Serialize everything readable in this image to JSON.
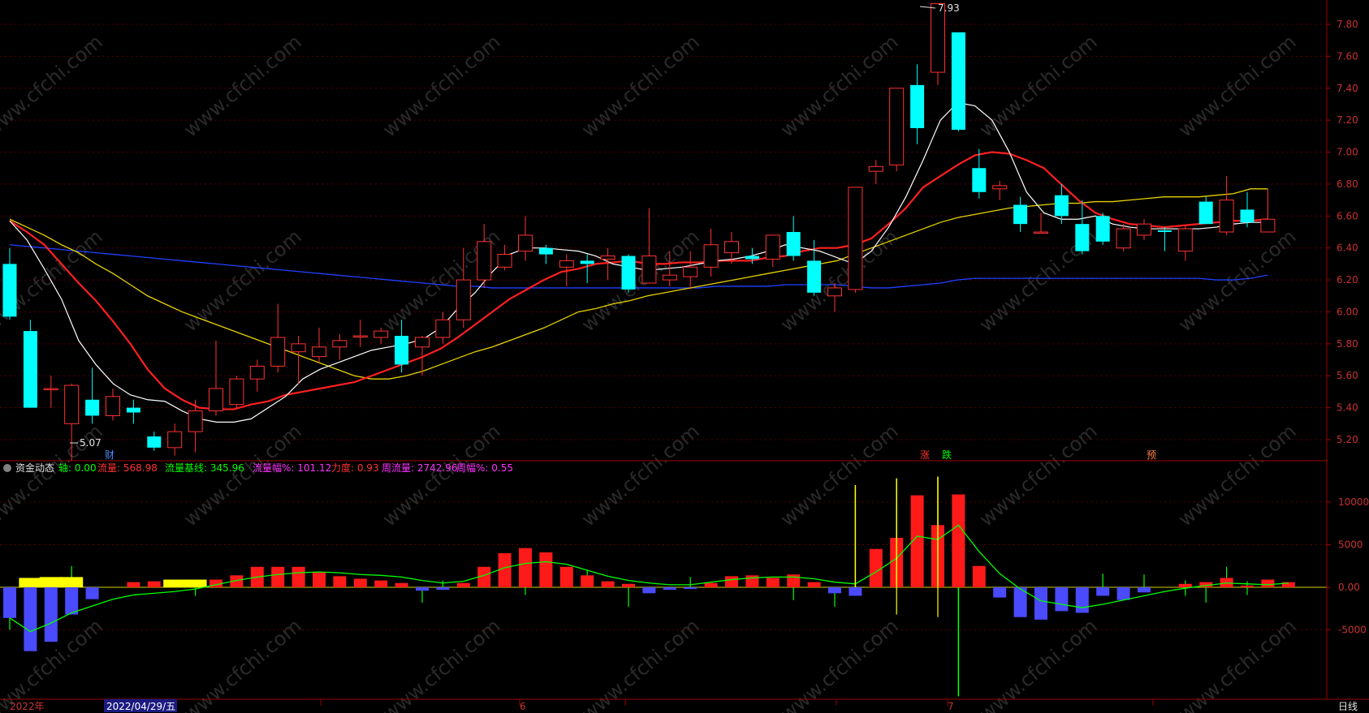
{
  "watermark": "www.cfchi.com",
  "colors": {
    "up": "#ff3232",
    "down": "#00ffff",
    "ma5": "#ffffff",
    "ma10": "#ff2020",
    "ma30": "#e6d200",
    "ma120": "#2040ff",
    "axis": "#a00000",
    "vol_pos": "#ff1a1a",
    "vol_neg": "#4a4aff",
    "vol_yellow": "#ffff00",
    "baseline": "#00ff00"
  },
  "indicator": {
    "name": "资金动态",
    "axis_label": "轴: 0.00",
    "flow_label": "流量: 568.98",
    "base_label": "流量基线: 345.96",
    "amp_label": "流量幅%: 101.12",
    "force_label": "力度: 0.93",
    "week_flow_label": "周流量: 2742.96",
    "week_amp_label": "周幅%: 0.55"
  },
  "annotations": {
    "high_label": "7.93",
    "low_label": "5.07",
    "marker_cai": "财",
    "marker_zhang": "涨",
    "marker_die": "跌",
    "marker_yu": "预"
  },
  "bottom_axis": {
    "year": "2022年",
    "cursor_date": "2022/04/29/五",
    "month6": "6",
    "month7": "7",
    "period": "日线"
  },
  "chart_data": [
    {
      "type": "candlestick",
      "ylim": [
        5.0,
        7.95
      ],
      "yticks": [
        "7.80",
        "7.60",
        "7.40",
        "7.20",
        "7.00",
        "6.80",
        "6.60",
        "6.40",
        "6.20",
        "6.00",
        "5.80",
        "5.60",
        "5.40",
        "5.20"
      ],
      "candles": [
        {
          "o": 6.3,
          "h": 6.4,
          "l": 5.95,
          "c": 5.97
        },
        {
          "o": 5.88,
          "h": 5.95,
          "l": 5.4,
          "c": 5.4
        },
        {
          "o": 5.52,
          "h": 5.6,
          "l": 5.4,
          "c": 5.52
        },
        {
          "o": 5.3,
          "h": 5.55,
          "l": 5.07,
          "c": 5.54
        },
        {
          "o": 5.45,
          "h": 5.65,
          "l": 5.3,
          "c": 5.35
        },
        {
          "o": 5.35,
          "h": 5.52,
          "l": 5.32,
          "c": 5.47
        },
        {
          "o": 5.4,
          "h": 5.45,
          "l": 5.3,
          "c": 5.37
        },
        {
          "o": 5.22,
          "h": 5.25,
          "l": 5.13,
          "c": 5.15
        },
        {
          "o": 5.15,
          "h": 5.3,
          "l": 5.1,
          "c": 5.25
        },
        {
          "o": 5.25,
          "h": 5.45,
          "l": 5.12,
          "c": 5.38
        },
        {
          "o": 5.38,
          "h": 5.82,
          "l": 5.35,
          "c": 5.52
        },
        {
          "o": 5.42,
          "h": 5.6,
          "l": 5.4,
          "c": 5.58
        },
        {
          "o": 5.58,
          "h": 5.7,
          "l": 5.5,
          "c": 5.66
        },
        {
          "o": 5.66,
          "h": 6.05,
          "l": 5.62,
          "c": 5.84
        },
        {
          "o": 5.75,
          "h": 5.85,
          "l": 5.55,
          "c": 5.8
        },
        {
          "o": 5.72,
          "h": 5.9,
          "l": 5.68,
          "c": 5.78
        },
        {
          "o": 5.78,
          "h": 5.86,
          "l": 5.7,
          "c": 5.82
        },
        {
          "o": 5.85,
          "h": 5.95,
          "l": 5.78,
          "c": 5.85
        },
        {
          "o": 5.84,
          "h": 5.9,
          "l": 5.8,
          "c": 5.88
        },
        {
          "o": 5.85,
          "h": 5.95,
          "l": 5.62,
          "c": 5.67
        },
        {
          "o": 5.78,
          "h": 5.85,
          "l": 5.6,
          "c": 5.84
        },
        {
          "o": 5.84,
          "h": 6.0,
          "l": 5.8,
          "c": 5.95
        },
        {
          "o": 5.95,
          "h": 6.4,
          "l": 5.9,
          "c": 6.2
        },
        {
          "o": 6.2,
          "h": 6.55,
          "l": 6.15,
          "c": 6.44
        },
        {
          "o": 6.28,
          "h": 6.42,
          "l": 6.26,
          "c": 6.36
        },
        {
          "o": 6.38,
          "h": 6.6,
          "l": 6.32,
          "c": 6.48
        },
        {
          "o": 6.4,
          "h": 6.42,
          "l": 6.3,
          "c": 6.36
        },
        {
          "o": 6.28,
          "h": 6.36,
          "l": 6.16,
          "c": 6.32
        },
        {
          "o": 6.32,
          "h": 6.36,
          "l": 6.18,
          "c": 6.3
        },
        {
          "o": 6.33,
          "h": 6.4,
          "l": 6.2,
          "c": 6.35
        },
        {
          "o": 6.35,
          "h": 6.36,
          "l": 6.12,
          "c": 6.14
        },
        {
          "o": 6.18,
          "h": 6.65,
          "l": 6.18,
          "c": 6.35
        },
        {
          "o": 6.2,
          "h": 6.38,
          "l": 6.16,
          "c": 6.23
        },
        {
          "o": 6.22,
          "h": 6.38,
          "l": 6.14,
          "c": 6.28
        },
        {
          "o": 6.28,
          "h": 6.52,
          "l": 6.22,
          "c": 6.42
        },
        {
          "o": 6.37,
          "h": 6.5,
          "l": 6.3,
          "c": 6.44
        },
        {
          "o": 6.35,
          "h": 6.4,
          "l": 6.3,
          "c": 6.33
        },
        {
          "o": 6.33,
          "h": 6.48,
          "l": 6.28,
          "c": 6.48
        },
        {
          "o": 6.5,
          "h": 6.6,
          "l": 6.32,
          "c": 6.35
        },
        {
          "o": 6.32,
          "h": 6.45,
          "l": 6.1,
          "c": 6.12
        },
        {
          "o": 6.1,
          "h": 6.18,
          "l": 6.0,
          "c": 6.15
        },
        {
          "o": 6.14,
          "h": 6.78,
          "l": 6.12,
          "c": 6.78
        },
        {
          "o": 6.88,
          "h": 6.95,
          "l": 6.8,
          "c": 6.91
        },
        {
          "o": 6.92,
          "h": 7.4,
          "l": 6.88,
          "c": 7.4
        },
        {
          "o": 7.42,
          "h": 7.55,
          "l": 7.05,
          "c": 7.15
        },
        {
          "o": 7.5,
          "h": 7.93,
          "l": 7.42,
          "c": 7.93
        },
        {
          "o": 7.75,
          "h": 7.75,
          "l": 7.13,
          "c": 7.14
        },
        {
          "o": 6.9,
          "h": 7.02,
          "l": 6.71,
          "c": 6.75
        },
        {
          "o": 6.77,
          "h": 6.82,
          "l": 6.7,
          "c": 6.79
        },
        {
          "o": 6.67,
          "h": 6.72,
          "l": 6.5,
          "c": 6.55
        },
        {
          "o": 6.5,
          "h": 6.62,
          "l": 6.49,
          "c": 6.5
        },
        {
          "o": 6.73,
          "h": 6.8,
          "l": 6.55,
          "c": 6.6
        },
        {
          "o": 6.55,
          "h": 6.7,
          "l": 6.36,
          "c": 6.38
        },
        {
          "o": 6.6,
          "h": 6.62,
          "l": 6.42,
          "c": 6.44
        },
        {
          "o": 6.4,
          "h": 6.55,
          "l": 6.38,
          "c": 6.52
        },
        {
          "o": 6.48,
          "h": 6.58,
          "l": 6.45,
          "c": 6.55
        },
        {
          "o": 6.51,
          "h": 6.53,
          "l": 6.38,
          "c": 6.5
        },
        {
          "o": 6.38,
          "h": 6.54,
          "l": 6.32,
          "c": 6.52
        },
        {
          "o": 6.69,
          "h": 6.72,
          "l": 6.55,
          "c": 6.55
        },
        {
          "o": 6.5,
          "h": 6.85,
          "l": 6.48,
          "c": 6.7
        },
        {
          "o": 6.64,
          "h": 6.75,
          "l": 6.53,
          "c": 6.56
        },
        {
          "o": 6.5,
          "h": 6.77,
          "l": 6.5,
          "c": 6.58
        }
      ],
      "ma5": [
        6.57,
        6.45,
        6.27,
        6.08,
        5.82,
        5.67,
        5.55,
        5.48,
        5.45,
        5.44,
        5.38,
        5.33,
        5.31,
        5.31,
        5.33,
        5.4,
        5.47,
        5.58,
        5.64,
        5.68,
        5.72,
        5.76,
        5.78,
        5.8,
        5.83,
        5.9,
        6.02,
        6.12,
        6.25,
        6.36,
        6.4,
        6.4,
        6.39,
        6.38,
        6.35,
        6.3,
        6.28,
        6.26,
        6.27,
        6.28,
        6.3,
        6.32,
        6.33,
        6.35,
        6.38,
        6.42,
        6.4,
        6.38,
        6.34,
        6.3,
        6.38,
        6.53,
        6.72,
        6.95,
        7.2,
        7.31,
        7.29,
        7.2,
        7.0,
        6.75,
        6.62,
        6.58,
        6.58,
        6.6,
        6.55,
        6.53,
        6.52,
        6.52,
        6.52,
        6.52,
        6.53,
        6.55,
        6.56,
        6.56
      ],
      "ma10": [
        6.57,
        6.5,
        6.42,
        6.3,
        6.18,
        6.07,
        5.94,
        5.8,
        5.64,
        5.52,
        5.45,
        5.4,
        5.39,
        5.39,
        5.42,
        5.44,
        5.48,
        5.5,
        5.52,
        5.54,
        5.56,
        5.6,
        5.64,
        5.68,
        5.72,
        5.77,
        5.84,
        5.92,
        6.0,
        6.08,
        6.14,
        6.2,
        6.25,
        6.27,
        6.3,
        6.31,
        6.32,
        6.3,
        6.3,
        6.31,
        6.31,
        6.32,
        6.32,
        6.32,
        6.34,
        6.35,
        6.38,
        6.4,
        6.4,
        6.42,
        6.46,
        6.55,
        6.65,
        6.78,
        6.85,
        6.92,
        6.98,
        7.0,
        6.99,
        6.95,
        6.9,
        6.8,
        6.7,
        6.62,
        6.58,
        6.55,
        6.54,
        6.53,
        6.54,
        6.55,
        6.56,
        6.57,
        6.57,
        6.58
      ],
      "ma30": [
        6.58,
        6.53,
        6.48,
        6.42,
        6.37,
        6.3,
        6.24,
        6.17,
        6.1,
        6.05,
        6.0,
        5.96,
        5.92,
        5.88,
        5.84,
        5.8,
        5.76,
        5.72,
        5.68,
        5.64,
        5.6,
        5.58,
        5.58,
        5.6,
        5.63,
        5.67,
        5.71,
        5.75,
        5.78,
        5.82,
        5.86,
        5.9,
        5.95,
        6.0,
        6.02,
        6.05,
        6.07,
        6.1,
        6.12,
        6.14,
        6.16,
        6.18,
        6.2,
        6.22,
        6.24,
        6.26,
        6.28,
        6.3,
        6.32,
        6.36,
        6.4,
        6.44,
        6.48,
        6.52,
        6.56,
        6.59,
        6.61,
        6.63,
        6.65,
        6.66,
        6.67,
        6.68,
        6.68,
        6.69,
        6.69,
        6.7,
        6.71,
        6.72,
        6.72,
        6.72,
        6.73,
        6.74,
        6.77,
        6.77
      ],
      "ma120": [
        6.42,
        6.41,
        6.4,
        6.39,
        6.38,
        6.37,
        6.36,
        6.35,
        6.34,
        6.33,
        6.32,
        6.31,
        6.3,
        6.29,
        6.28,
        6.27,
        6.26,
        6.25,
        6.24,
        6.23,
        6.22,
        6.21,
        6.2,
        6.19,
        6.18,
        6.17,
        6.16,
        6.16,
        6.15,
        6.15,
        6.15,
        6.15,
        6.15,
        6.15,
        6.15,
        6.15,
        6.15,
        6.15,
        6.15,
        6.15,
        6.15,
        6.16,
        6.16,
        6.16,
        6.16,
        6.17,
        6.17,
        6.17,
        6.17,
        6.16,
        6.15,
        6.15,
        6.16,
        6.17,
        6.18,
        6.2,
        6.21,
        6.21,
        6.21,
        6.21,
        6.21,
        6.21,
        6.21,
        6.21,
        6.21,
        6.21,
        6.21,
        6.21,
        6.21,
        6.21,
        6.2,
        6.2,
        6.21,
        6.23
      ]
    },
    {
      "type": "bar",
      "ylim": [
        -13000,
        14500
      ],
      "yticks": [
        "10000",
        "5000",
        "0.00",
        "-5000"
      ],
      "values": [
        -3600,
        -7500,
        -6400,
        -3200,
        -1400,
        0,
        600,
        700,
        600,
        800,
        900,
        1400,
        2400,
        2400,
        2400,
        1800,
        1300,
        1000,
        800,
        500,
        -400,
        -300,
        500,
        2400,
        4000,
        4600,
        4100,
        2400,
        1400,
        700,
        400,
        -700,
        -300,
        -200,
        500,
        1300,
        1400,
        1100,
        1500,
        600,
        -700,
        -1000,
        4500,
        5800,
        10800,
        7300,
        10900,
        2500,
        -1200,
        -3500,
        -3800,
        -2800,
        -3000,
        -1000,
        -1500,
        -600,
        0,
        400,
        600,
        1100,
        200,
        900,
        600
      ],
      "yellow": [
        -1,
        -1,
        -1,
        -1,
        -1,
        -1,
        -1,
        -1,
        -1,
        -1,
        -1,
        -1,
        -1,
        -1,
        -1,
        -1,
        -1,
        -1,
        -1,
        -1,
        -1,
        -1,
        -1,
        -1,
        -1,
        -1,
        -1,
        -1,
        -1,
        -1,
        -1,
        -1,
        -1,
        -1,
        -1,
        -1,
        -1,
        -1,
        -1,
        -1,
        -1,
        -1,
        -1,
        -1,
        -1,
        -1,
        -1,
        -1,
        -1,
        -1,
        -1,
        -1,
        -1,
        -1,
        -1,
        -1,
        -1,
        -1,
        -1,
        -1,
        -1,
        -1,
        -1
      ],
      "yellow_positions": [
        1,
        2,
        3,
        8,
        9
      ],
      "yellow_values": [
        1100,
        1200,
        1200,
        900,
        900
      ],
      "spikes": [
        {
          "i": 0,
          "lo": -5000,
          "hi": 0
        },
        {
          "i": 3,
          "lo": 0,
          "hi": 2500
        },
        {
          "i": 9,
          "lo": -1000,
          "hi": 900
        },
        {
          "i": 20,
          "lo": -1800,
          "hi": 0
        },
        {
          "i": 21,
          "lo": 0,
          "hi": 800
        },
        {
          "i": 25,
          "lo": -900,
          "hi": 4600
        },
        {
          "i": 28,
          "lo": 0,
          "hi": 2000
        },
        {
          "i": 30,
          "lo": -2300,
          "hi": 400
        },
        {
          "i": 33,
          "lo": 0,
          "hi": 1200
        },
        {
          "i": 38,
          "lo": -1500,
          "hi": 1500
        },
        {
          "i": 40,
          "lo": -2300,
          "hi": 0
        },
        {
          "i": 41,
          "lo": 0,
          "hi": 11500
        },
        {
          "i": 43,
          "lo": -3200,
          "hi": 12500
        },
        {
          "i": 45,
          "lo": -3500,
          "hi": 12800
        },
        {
          "i": 46,
          "lo": -12800,
          "hi": 0
        },
        {
          "i": 53,
          "lo": 0,
          "hi": 1600
        },
        {
          "i": 54,
          "lo": -1200,
          "hi": 0
        },
        {
          "i": 55,
          "lo": 0,
          "hi": 1500
        },
        {
          "i": 57,
          "lo": -1000,
          "hi": 800
        },
        {
          "i": 58,
          "lo": -1800,
          "hi": 0
        },
        {
          "i": 59,
          "lo": 0,
          "hi": 2400
        },
        {
          "i": 60,
          "lo": -900,
          "hi": 700
        }
      ],
      "baseline": [
        -3600,
        -5200,
        -4200,
        -3000,
        -2200,
        -1400,
        -900,
        -700,
        -500,
        -200,
        300,
        800,
        1200,
        1500,
        1700,
        1800,
        1700,
        1500,
        1400,
        1200,
        800,
        500,
        700,
        1400,
        2300,
        2800,
        3000,
        2700,
        2000,
        1300,
        800,
        500,
        300,
        300,
        600,
        900,
        1100,
        1200,
        1200,
        1000,
        600,
        400,
        1800,
        3400,
        6000,
        5600,
        7300,
        4200,
        1600,
        -200,
        -1600,
        -2000,
        -2400,
        -2000,
        -1500,
        -1000,
        -500,
        -100,
        200,
        500,
        400,
        300,
        500
      ]
    }
  ]
}
